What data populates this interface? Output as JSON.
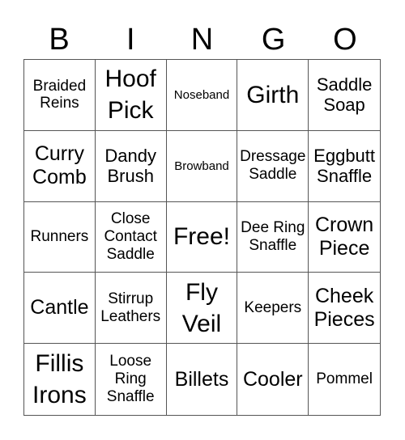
{
  "title": "BINGO",
  "header_letters": [
    "B",
    "I",
    "N",
    "G",
    "O"
  ],
  "cells": [
    {
      "text": "Braided Reins",
      "size": "s"
    },
    {
      "text": "Hoof Pick",
      "size": "xl"
    },
    {
      "text": "Noseband",
      "size": "xs"
    },
    {
      "text": "Girth",
      "size": "xl"
    },
    {
      "text": "Saddle Soap",
      "size": "m"
    },
    {
      "text": "Curry Comb",
      "size": "l"
    },
    {
      "text": "Dandy Brush",
      "size": "m"
    },
    {
      "text": "Browband",
      "size": "xs"
    },
    {
      "text": "Dressage Saddle",
      "size": "s"
    },
    {
      "text": "Eggbutt Snaffle",
      "size": "m"
    },
    {
      "text": "Runners",
      "size": "s"
    },
    {
      "text": "Close Contact Saddle",
      "size": "s"
    },
    {
      "text": "Free!",
      "size": "xl"
    },
    {
      "text": "Dee Ring Snaffle",
      "size": "s"
    },
    {
      "text": "Crown Piece",
      "size": "l"
    },
    {
      "text": "Cantle",
      "size": "l"
    },
    {
      "text": "Stirrup Leathers",
      "size": "s"
    },
    {
      "text": "Fly Veil",
      "size": "xl"
    },
    {
      "text": "Keepers",
      "size": "s"
    },
    {
      "text": "Cheek Pieces",
      "size": "l"
    },
    {
      "text": "Fillis Irons",
      "size": "xl"
    },
    {
      "text": "Loose Ring Snaffle",
      "size": "s"
    },
    {
      "text": "Billets",
      "size": "l"
    },
    {
      "text": "Cooler",
      "size": "l"
    },
    {
      "text": "Pommel",
      "size": "s"
    }
  ]
}
